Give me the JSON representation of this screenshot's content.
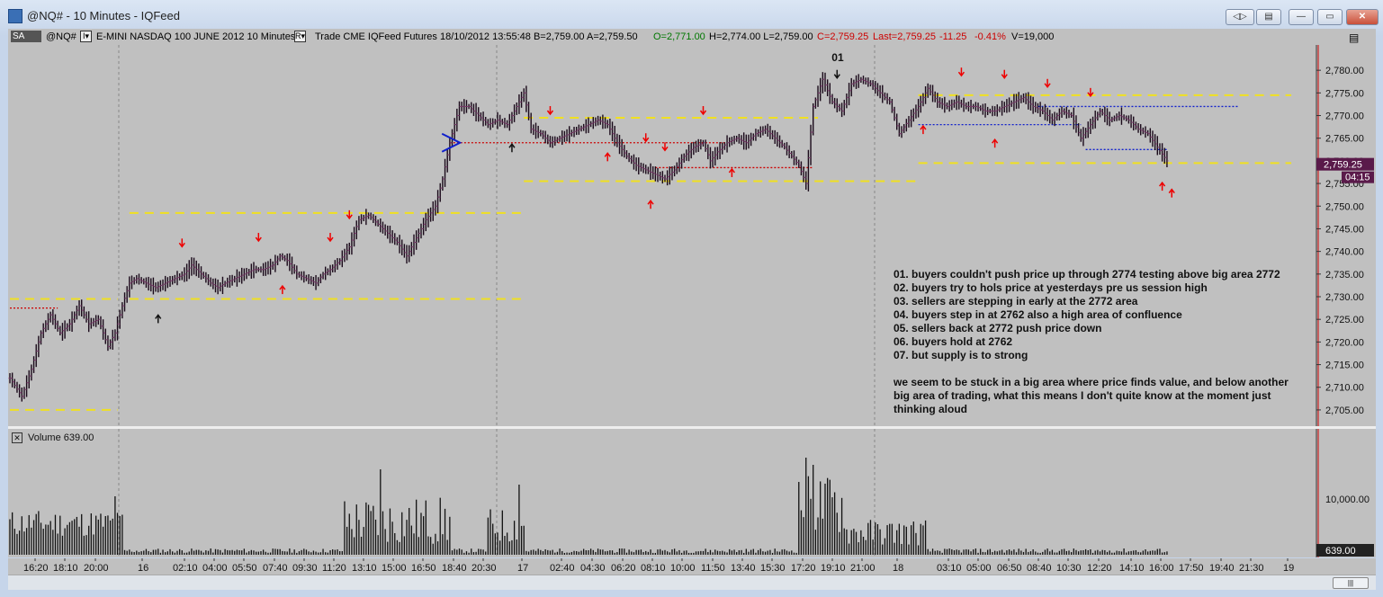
{
  "window": {
    "title": "@NQ# - 10 Minutes - IQFeed",
    "buttons": [
      "◁▷",
      "▤",
      "—",
      "▭",
      "✕"
    ]
  },
  "infobar": {
    "sa": "SA",
    "symbol": "@NQ#",
    "interval_icon": "I▾",
    "description": "E-MINI NASDAQ 100 JUNE 2012  10 Minutes",
    "r_icon": "R▾",
    "fields": "Trade  CME  IQFeed  Futures  18/10/2012  13:55:48  B=2,759.00  A=2,759.50",
    "open": "O=2,771.00",
    "high_low": "H=2,774.00  L=2,759.00",
    "close": "C=2,759.25",
    "last": "Last=2,759.25",
    "change": "-11.25",
    "pct": "-0.41%",
    "volume": "V=19,000"
  },
  "colors": {
    "up_bar": "#222222",
    "accent_red": "#cc0000",
    "accent_green": "#007700",
    "level_yellow": "#f0e020",
    "level_blue": "#1020cc",
    "price_tag": "#5a1a4a"
  },
  "chart_data": {
    "type": "bar",
    "instrument": "E-MINI NASDAQ 100 JUNE 2012",
    "timeframe": "10 Minutes",
    "ylim": [
      2703,
      2784
    ],
    "y_ticks": [
      "2,780.00",
      "2,775.00",
      "2,770.00",
      "2,765.00",
      "2,760.00",
      "2,755.00",
      "2,750.00",
      "2,745.00",
      "2,740.00",
      "2,735.00",
      "2,730.00",
      "2,725.00",
      "2,720.00",
      "2,715.00",
      "2,710.00",
      "2,705.00"
    ],
    "last_price_tag": "2,759.25",
    "countdown_tag": "04:15",
    "x_ticks": [
      "16:20",
      "18:10",
      "20:00",
      "16",
      "02:10",
      "04:00",
      "05:50",
      "07:40",
      "09:30",
      "11:20",
      "13:10",
      "15:00",
      "16:50",
      "18:40",
      "20:30",
      "17",
      "02:40",
      "04:30",
      "06:20",
      "08:10",
      "10:00",
      "11:50",
      "13:40",
      "15:30",
      "17:20",
      "19:10",
      "21:00",
      "18",
      "03:10",
      "05:00",
      "06:50",
      "08:40",
      "10:30",
      "12:20",
      "14:10",
      "16:00",
      "17:50",
      "19:40",
      "21:30",
      "19"
    ],
    "price_path": [
      [
        0,
        2712
      ],
      [
        5,
        2708
      ],
      [
        9,
        2714
      ],
      [
        13,
        2722
      ],
      [
        17,
        2726
      ],
      [
        21,
        2722
      ],
      [
        25,
        2724
      ],
      [
        29,
        2728
      ],
      [
        33,
        2724
      ],
      [
        37,
        2725
      ],
      [
        41,
        2719
      ],
      [
        44,
        2722
      ],
      [
        47,
        2728
      ],
      [
        50,
        2733
      ],
      [
        53,
        2734
      ],
      [
        57,
        2733
      ],
      [
        61,
        2732
      ],
      [
        65,
        2733
      ],
      [
        69,
        2734
      ],
      [
        73,
        2735
      ],
      [
        76,
        2737
      ],
      [
        80,
        2735
      ],
      [
        84,
        2733
      ],
      [
        87,
        2732
      ],
      [
        90,
        2733
      ],
      [
        94,
        2734
      ],
      [
        98,
        2735
      ],
      [
        102,
        2736
      ],
      [
        106,
        2736
      ],
      [
        110,
        2737
      ],
      [
        113,
        2739
      ],
      [
        116,
        2738
      ],
      [
        120,
        2735
      ],
      [
        124,
        2734
      ],
      [
        128,
        2733
      ],
      [
        131,
        2735
      ],
      [
        134,
        2736
      ],
      [
        138,
        2738
      ],
      [
        142,
        2741
      ],
      [
        146,
        2747
      ],
      [
        150,
        2748
      ],
      [
        154,
        2746
      ],
      [
        158,
        2744
      ],
      [
        162,
        2742
      ],
      [
        166,
        2739
      ],
      [
        170,
        2743
      ],
      [
        174,
        2747
      ],
      [
        178,
        2750
      ],
      [
        181,
        2756
      ],
      [
        184,
        2764
      ],
      [
        188,
        2772
      ],
      [
        192,
        2772
      ],
      [
        196,
        2770
      ],
      [
        200,
        2768
      ],
      [
        204,
        2769
      ],
      [
        208,
        2768
      ],
      [
        212,
        2772
      ],
      [
        215,
        2775
      ],
      [
        218,
        2767
      ],
      [
        222,
        2766
      ],
      [
        226,
        2764
      ],
      [
        230,
        2765
      ],
      [
        234,
        2766
      ],
      [
        238,
        2767
      ],
      [
        242,
        2768
      ],
      [
        246,
        2769
      ],
      [
        250,
        2768
      ],
      [
        254,
        2764
      ],
      [
        258,
        2761
      ],
      [
        262,
        2759
      ],
      [
        266,
        2758
      ],
      [
        270,
        2757
      ],
      [
        274,
        2756
      ],
      [
        278,
        2758
      ],
      [
        282,
        2761
      ],
      [
        286,
        2763
      ],
      [
        290,
        2764
      ],
      [
        293,
        2760
      ],
      [
        296,
        2762
      ],
      [
        300,
        2764
      ],
      [
        304,
        2765
      ],
      [
        308,
        2764
      ],
      [
        312,
        2766
      ],
      [
        316,
        2767
      ],
      [
        320,
        2765
      ],
      [
        324,
        2763
      ],
      [
        327,
        2761
      ],
      [
        330,
        2759
      ],
      [
        333,
        2755
      ],
      [
        336,
        2772
      ],
      [
        340,
        2778
      ],
      [
        344,
        2773
      ],
      [
        348,
        2771
      ],
      [
        352,
        2777
      ],
      [
        356,
        2778
      ],
      [
        360,
        2777
      ],
      [
        364,
        2775
      ],
      [
        368,
        2773
      ],
      [
        372,
        2766
      ],
      [
        376,
        2769
      ],
      [
        380,
        2772
      ],
      [
        384,
        2776
      ],
      [
        388,
        2773
      ],
      [
        392,
        2772
      ],
      [
        396,
        2773
      ],
      [
        400,
        2772
      ],
      [
        404,
        2772
      ],
      [
        408,
        2771
      ],
      [
        412,
        2771
      ],
      [
        416,
        2772
      ],
      [
        420,
        2773
      ],
      [
        424,
        2774
      ],
      [
        428,
        2772
      ],
      [
        432,
        2771
      ],
      [
        436,
        2769
      ],
      [
        440,
        2771
      ],
      [
        444,
        2770
      ],
      [
        448,
        2765
      ],
      [
        452,
        2768
      ],
      [
        456,
        2771
      ],
      [
        460,
        2769
      ],
      [
        464,
        2770
      ],
      [
        468,
        2769
      ],
      [
        472,
        2767
      ],
      [
        476,
        2766
      ],
      [
        480,
        2763
      ],
      [
        484,
        2760
      ]
    ],
    "volume_panel": {
      "label": "Volume",
      "value": "639.00",
      "y_tick": "10,000.00",
      "last_tag": "639.00"
    },
    "levels": [
      {
        "style": "yellow-dash",
        "from": 0,
        "to": 45,
        "price": 2729.5
      },
      {
        "style": "yellow-dash",
        "from": 0,
        "to": 45,
        "price": 2705
      },
      {
        "style": "yellow-dash",
        "from": 50,
        "to": 215,
        "price": 2748.5
      },
      {
        "style": "yellow-dash",
        "from": 215,
        "to": 338,
        "price": 2769.5
      },
      {
        "style": "yellow-dash",
        "from": 215,
        "to": 380,
        "price": 2755.5
      },
      {
        "style": "yellow-dash",
        "from": 50,
        "to": 215,
        "price": 2729.5
      },
      {
        "style": "yellow-dash",
        "from": 380,
        "to": 536,
        "price": 2774.5
      },
      {
        "style": "yellow-dash",
        "from": 380,
        "to": 536,
        "price": 2759.5
      },
      {
        "style": "red-dot",
        "from": 0,
        "to": 20,
        "price": 2727.5
      },
      {
        "style": "red-dot",
        "from": 184,
        "to": 300,
        "price": 2764
      },
      {
        "style": "red-dot",
        "from": 270,
        "to": 336,
        "price": 2758.5
      },
      {
        "style": "blue-dot",
        "from": 380,
        "to": 448,
        "price": 2768
      },
      {
        "style": "blue-dot",
        "from": 430,
        "to": 514,
        "price": 2772
      },
      {
        "style": "blue-dot",
        "from": 450,
        "to": 484,
        "price": 2762.5
      }
    ],
    "annotation_label": "01",
    "notes": [
      "01. buyers couldn't push price up through 2774 testing above big area 2772",
      "02. buyers try to hols price at yesterdays pre us session high",
      "03. sellers are stepping in early at the 2772 area",
      "04. buyers step in at 2762 also a high area of confluence",
      "05. sellers back at 2772 push price down",
      "06. buyers hold at 2762",
      "07. but supply is to strong",
      "",
      "we seem to be stuck in a big area where price finds value, and below another",
      "big area of trading, what this means I don't quite know at the moment just",
      "thinking aloud"
    ]
  }
}
